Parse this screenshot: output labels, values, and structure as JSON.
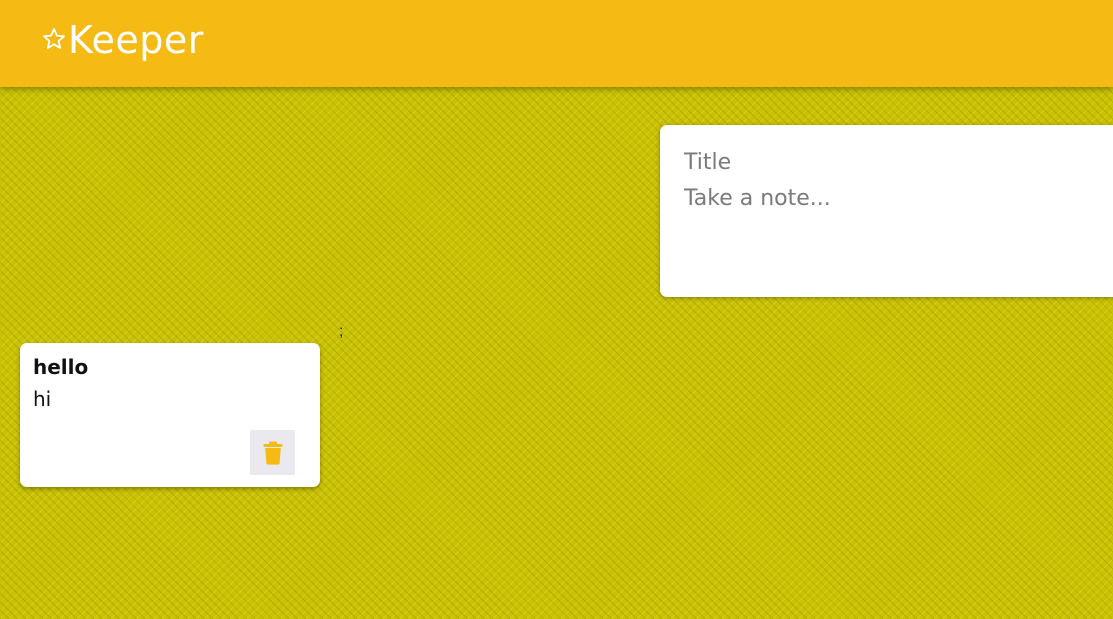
{
  "header": {
    "title": "Keeper",
    "logo_icon": "star-outline-icon",
    "background_color": "#f5ba13"
  },
  "create_area": {
    "title_placeholder": "Title",
    "content_placeholder": "Take a note..."
  },
  "stray_text": ";",
  "notes": [
    {
      "title": "hello",
      "content": "hi",
      "delete_icon": "trash-icon",
      "icon_color": "#f5ba13"
    }
  ],
  "page": {
    "background_color": "#c9c203"
  }
}
